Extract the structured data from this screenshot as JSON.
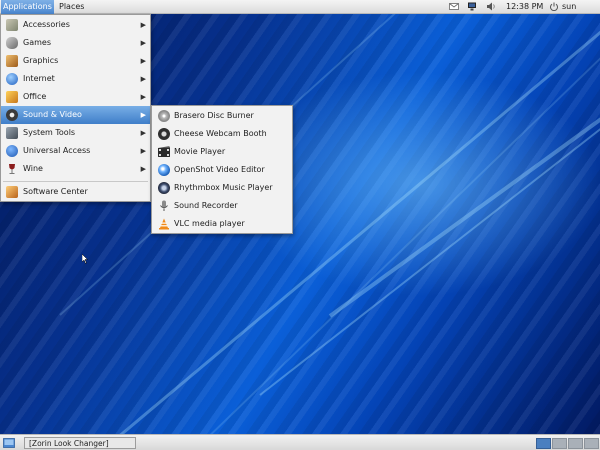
{
  "top_panel": {
    "applications_label": "Applications",
    "places_label": "Places",
    "clock": "12:38 PM",
    "user": "sun",
    "tray_icons": [
      "mail-icon",
      "network-icon",
      "volume-icon",
      "power-icon"
    ]
  },
  "applications_menu": {
    "items": [
      {
        "label": "Accessories",
        "icon": "accessories-icon",
        "color": "#8a8f7a"
      },
      {
        "label": "Games",
        "icon": "games-icon",
        "color": "#7a7a7a"
      },
      {
        "label": "Graphics",
        "icon": "graphics-icon",
        "color": "#c0832e"
      },
      {
        "label": "Internet",
        "icon": "internet-icon",
        "color": "#2f6fc7"
      },
      {
        "label": "Office",
        "icon": "office-icon",
        "color": "#d9a02a"
      },
      {
        "label": "Sound & Video",
        "icon": "sound-video-icon",
        "color": "#4a4a4a"
      },
      {
        "label": "System Tools",
        "icon": "system-tools-icon",
        "color": "#5c6670"
      },
      {
        "label": "Universal Access",
        "icon": "universal-access-icon",
        "color": "#2d6dc4"
      },
      {
        "label": "Wine",
        "icon": "wine-icon",
        "color": "#8c1c1c"
      },
      {
        "label": "Software Center",
        "icon": "software-center-icon",
        "color": "#c8772a"
      }
    ],
    "highlighted": "Sound & Video"
  },
  "sound_video_submenu": {
    "items": [
      {
        "label": "Brasero Disc Burner",
        "icon": "disc-burner-icon",
        "color": "#9a9a9a"
      },
      {
        "label": "Cheese Webcam Booth",
        "icon": "webcam-icon",
        "color": "#3b3b3b"
      },
      {
        "label": "Movie Player",
        "icon": "movie-player-icon",
        "color": "#2b2b2b"
      },
      {
        "label": "OpenShot Video Editor",
        "icon": "video-editor-icon",
        "color": "#2a6fc2"
      },
      {
        "label": "Rhythmbox Music Player",
        "icon": "music-player-icon",
        "color": "#4a5a78"
      },
      {
        "label": "Sound Recorder",
        "icon": "microphone-icon",
        "color": "#6a6a6a"
      },
      {
        "label": "VLC media player",
        "icon": "vlc-icon",
        "color": "#f08a1a"
      }
    ]
  },
  "bottom_panel": {
    "task_label": "[Zorin Look Changer]",
    "workspaces": 4,
    "active_workspace": 1
  },
  "colors": {
    "highlight": "#4a86cf",
    "desktop_dark": "#031552",
    "desktop_light": "#0a5fd8"
  }
}
